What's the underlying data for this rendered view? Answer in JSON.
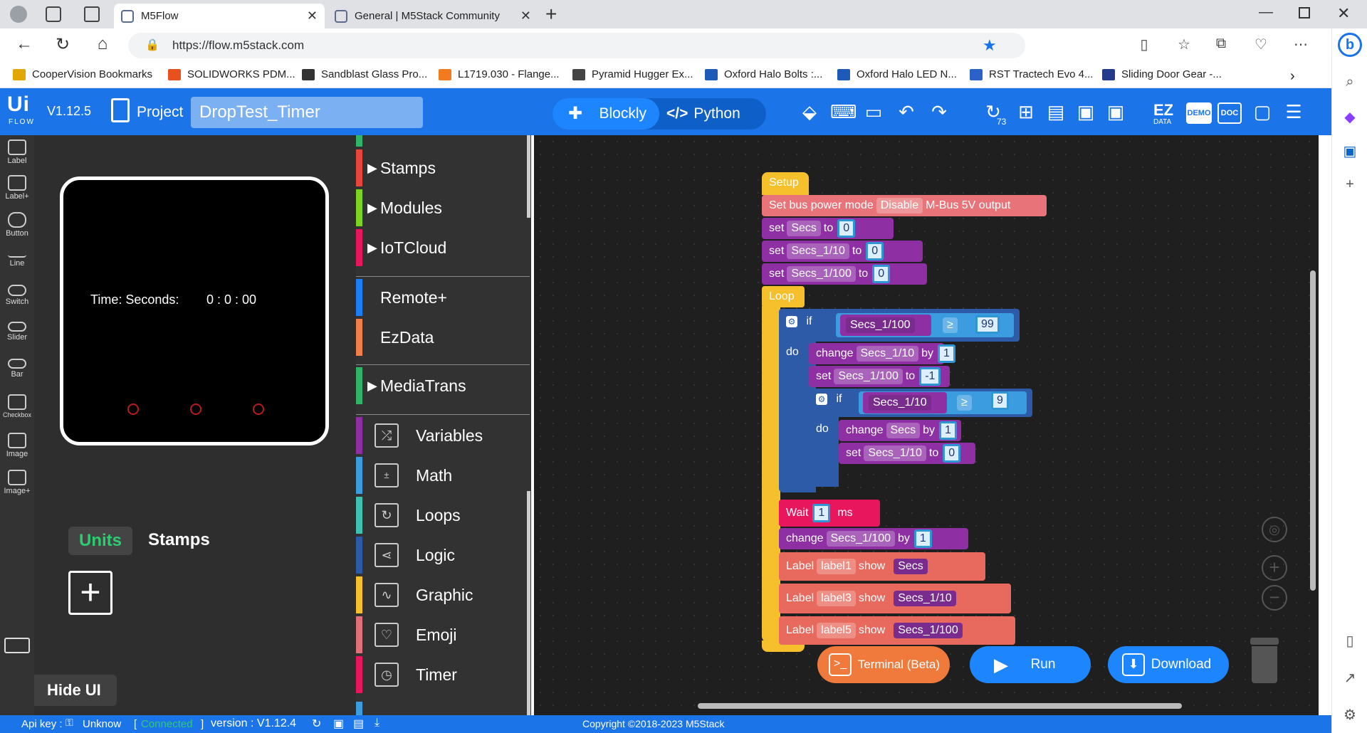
{
  "browser": {
    "tabs": [
      {
        "title": "M5Flow",
        "active": true
      },
      {
        "title": "General | M5Stack Community",
        "active": false
      }
    ],
    "url": "https://flow.m5stack.com",
    "bookmarks": [
      {
        "label": "CooperVision Bookmarks",
        "color": "#e0a800"
      },
      {
        "label": "SOLIDWORKS PDM...",
        "color": "#e8501e"
      },
      {
        "label": "Sandblast Glass Pro...",
        "color": "#333333"
      },
      {
        "label": "L1719.030 - Flange...",
        "color": "#f47a20"
      },
      {
        "label": "Pyramid Hugger Ex...",
        "color": "#444444"
      },
      {
        "label": "Oxford Halo Bolts :...",
        "color": "#1e5bb8"
      },
      {
        "label": "Oxford Halo LED N...",
        "color": "#1e5bb8"
      },
      {
        "label": "RST Tractech Evo 4...",
        "color": "#2a62c9"
      },
      {
        "label": "Sliding Door Gear -...",
        "color": "#243a8a"
      }
    ]
  },
  "app": {
    "logo": "Ui FLOW",
    "version": "V1.12.5",
    "project_label": "Project",
    "project_name": "DropTest_Timer",
    "modes": {
      "blockly": "Blockly",
      "python": "Python"
    },
    "history_count": "73",
    "ez_label": "EZ",
    "ez_sub": "DATA",
    "demo_label": "DEMO",
    "doc_label": "DOC"
  },
  "tools": [
    "Label",
    "Label+",
    "Button",
    "Line",
    "Switch",
    "Slider",
    "Bar",
    "Checkbox",
    "Image",
    "Image+"
  ],
  "device": {
    "label_text": "Time: Seconds:",
    "time_text": "0 : 0 : 00"
  },
  "units_tabs": {
    "units": "Units",
    "stamps": "Stamps"
  },
  "hide_ui": "Hide UI",
  "categories": [
    {
      "label": "Stamps",
      "color": "#e8453c",
      "arrow": true
    },
    {
      "label": "Modules",
      "color": "#7ed321",
      "arrow": true
    },
    {
      "label": "IoTCloud",
      "color": "#e8175d",
      "arrow": true
    },
    {
      "label": "Remote+",
      "color": "#1d7ff5",
      "arrow": false
    },
    {
      "label": "EzData",
      "color": "#f0804a",
      "arrow": false
    },
    {
      "label": "MediaTrans",
      "color": "#2fb566",
      "arrow": true
    },
    {
      "label": "Variables",
      "color": "#8e2fa3",
      "arrow": false
    },
    {
      "label": "Math",
      "color": "#3b9de0",
      "arrow": false
    },
    {
      "label": "Loops",
      "color": "#3cc1b2",
      "arrow": false
    },
    {
      "label": "Logic",
      "color": "#2d5ba8",
      "arrow": false
    },
    {
      "label": "Graphic",
      "color": "#f6c02d",
      "arrow": false
    },
    {
      "label": "Emoji",
      "color": "#e0707a",
      "arrow": false
    },
    {
      "label": "Timer",
      "color": "#e8175d",
      "arrow": false
    }
  ],
  "blocks": {
    "setup": "Setup",
    "bus_power": {
      "prefix": "Set bus power mode",
      "mode": "Disable",
      "suffix": "M-Bus 5V output"
    },
    "set1": {
      "kw": "set",
      "var": "Secs",
      "to": "to",
      "val": "0"
    },
    "set2": {
      "kw": "set",
      "var": "Secs_1/10",
      "to": "to",
      "val": "0"
    },
    "set3": {
      "kw": "set",
      "var": "Secs_1/100",
      "to": "to",
      "val": "0"
    },
    "loop": "Loop",
    "if1": {
      "kw": "if",
      "var": "Secs_1/100",
      "op": "≥",
      "val": "99"
    },
    "do": "do",
    "change1": {
      "kw": "change",
      "var": "Secs_1/10",
      "by": "by",
      "val": "1"
    },
    "set4": {
      "kw": "set",
      "var": "Secs_1/100",
      "to": "to",
      "val": "-1"
    },
    "if2": {
      "kw": "if",
      "var": "Secs_1/10",
      "op": "≥",
      "val": "9"
    },
    "change2": {
      "kw": "change",
      "var": "Secs",
      "by": "by",
      "val": "1"
    },
    "set5": {
      "kw": "set",
      "var": "Secs_1/10",
      "to": "to",
      "val": "0"
    },
    "wait": {
      "kw": "Wait",
      "val": "1",
      "unit": "ms"
    },
    "change3": {
      "kw": "change",
      "var": "Secs_1/100",
      "by": "by",
      "val": "1"
    },
    "label1": {
      "kw": "Label",
      "name": "label1",
      "show": "show",
      "var": "Secs"
    },
    "label3": {
      "kw": "Label",
      "name": "label3",
      "show": "show",
      "var": "Secs_1/10"
    },
    "label5": {
      "kw": "Label",
      "name": "label5",
      "show": "show",
      "var": "Secs_1/100"
    }
  },
  "actions": {
    "terminal": "Terminal (Beta)",
    "run": "Run",
    "download": "Download"
  },
  "status": {
    "api_key": "Api key :",
    "api_val": "Unknow",
    "connected": "Connected",
    "version": "version : V1.12.4",
    "copyright": "Copyright ©2018-2023 M5Stack"
  }
}
